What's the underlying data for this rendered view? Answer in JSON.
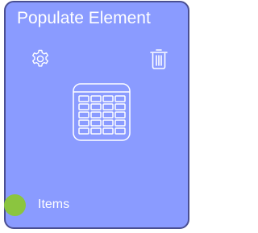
{
  "node": {
    "title": "Populate Element",
    "icons": {
      "settings": "gear-icon",
      "delete": "trash-icon",
      "type": "table-icon"
    },
    "output_port": {
      "label": "Items",
      "color": "#8BC53F"
    },
    "colors": {
      "background": "#8A9BFF",
      "border": "#4A4F92",
      "text": "#ffffff"
    }
  }
}
